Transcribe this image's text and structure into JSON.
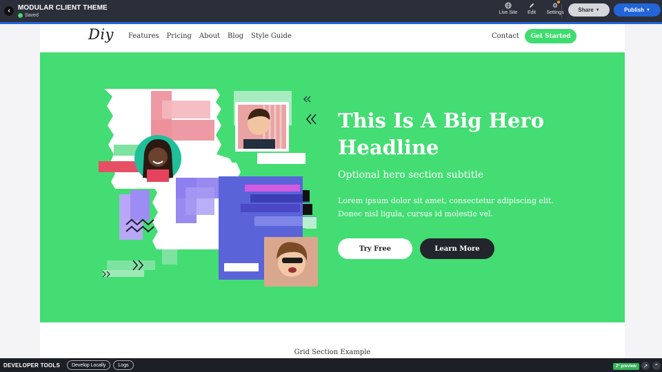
{
  "editor": {
    "title": "MODULAR CLIENT THEME",
    "status": "Saved",
    "actions": [
      {
        "label": "Live Site",
        "icon": "globe-icon"
      },
      {
        "label": "Edit",
        "icon": "pencil-icon"
      },
      {
        "label": "Settings",
        "icon": "gear-icon"
      }
    ],
    "share_label": "Share",
    "publish_label": "Publish"
  },
  "site": {
    "logo": "Diy",
    "nav": [
      "Features",
      "Pricing",
      "About",
      "Blog",
      "Style Guide"
    ],
    "contact": "Contact",
    "cta": "Get Started",
    "hero": {
      "title": "This Is A Big Hero Headline",
      "subtitle": "Optional hero section subtitle",
      "body": "Lorem ipsum dolor sit amet, consectetur adipiscing elit. Donec nisl ligula, cursus id molestie vel.",
      "primary_button": "Try Free",
      "secondary_button": "Learn More"
    },
    "grid_section_label": "Grid Section Example"
  },
  "devtools": {
    "title": "DEVELOPER TOOLS",
    "develop_locally": "Develop Locally",
    "logs": "Logs",
    "preview_badge": "2° preview"
  },
  "colors": {
    "hero_green": "#43dd73",
    "cta_green": "#3fdc70",
    "publish_blue": "#2265d9",
    "topbar": "#2b2f3a",
    "dark_button": "#22252b"
  }
}
